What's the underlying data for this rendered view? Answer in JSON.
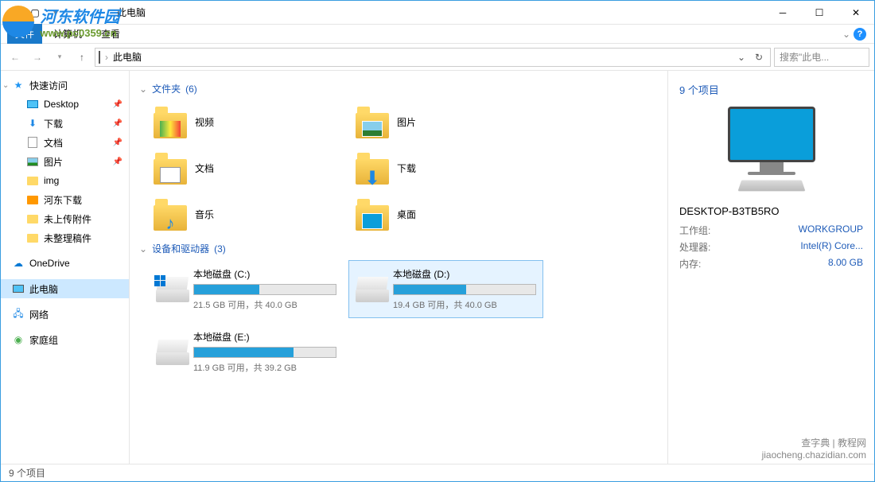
{
  "window": {
    "title": "此电脑"
  },
  "ribbon": {
    "file": "文件",
    "computer": "计算机",
    "view": "查看"
  },
  "nav": {
    "breadcrumb": "此电脑",
    "search_placeholder": "搜索\"此电..."
  },
  "sidebar": {
    "quick_access": "快速访问",
    "desktop": "Desktop",
    "downloads": "下载",
    "documents": "文档",
    "pictures": "图片",
    "img": "img",
    "hedong": "河东下载",
    "unuploaded": "未上传附件",
    "unsorted": "未整理稿件",
    "onedrive": "OneDrive",
    "thispc": "此电脑",
    "network": "网络",
    "homegroup": "家庭组"
  },
  "groups": {
    "folders": {
      "label": "文件夹",
      "count": "(6)"
    },
    "devices": {
      "label": "设备和驱动器",
      "count": "(3)"
    }
  },
  "folders": {
    "video": "视频",
    "pictures": "图片",
    "documents": "文档",
    "downloads": "下载",
    "music": "音乐",
    "desktop": "桌面"
  },
  "drives": [
    {
      "name": "本地磁盘 (C:)",
      "text": "21.5 GB 可用，共 40.0 GB",
      "fill": 46
    },
    {
      "name": "本地磁盘 (D:)",
      "text": "19.4 GB 可用，共 40.0 GB",
      "fill": 51,
      "selected": true
    },
    {
      "name": "本地磁盘 (E:)",
      "text": "11.9 GB 可用，共 39.2 GB",
      "fill": 70
    }
  ],
  "details": {
    "title": "9 个项目",
    "name": "DESKTOP-B3TB5RO",
    "workgroup_label": "工作组:",
    "workgroup": "WORKGROUP",
    "cpu_label": "处理器:",
    "cpu": "Intel(R) Core...",
    "ram_label": "内存:",
    "ram": "8.00 GB"
  },
  "status": {
    "text": "9 个项目"
  },
  "watermark": {
    "t1": "河东软件园",
    "t2": "www.pc0359.cn",
    "b1": "查字典 | 教程网",
    "b2": "jiaocheng.chazidian.com"
  }
}
